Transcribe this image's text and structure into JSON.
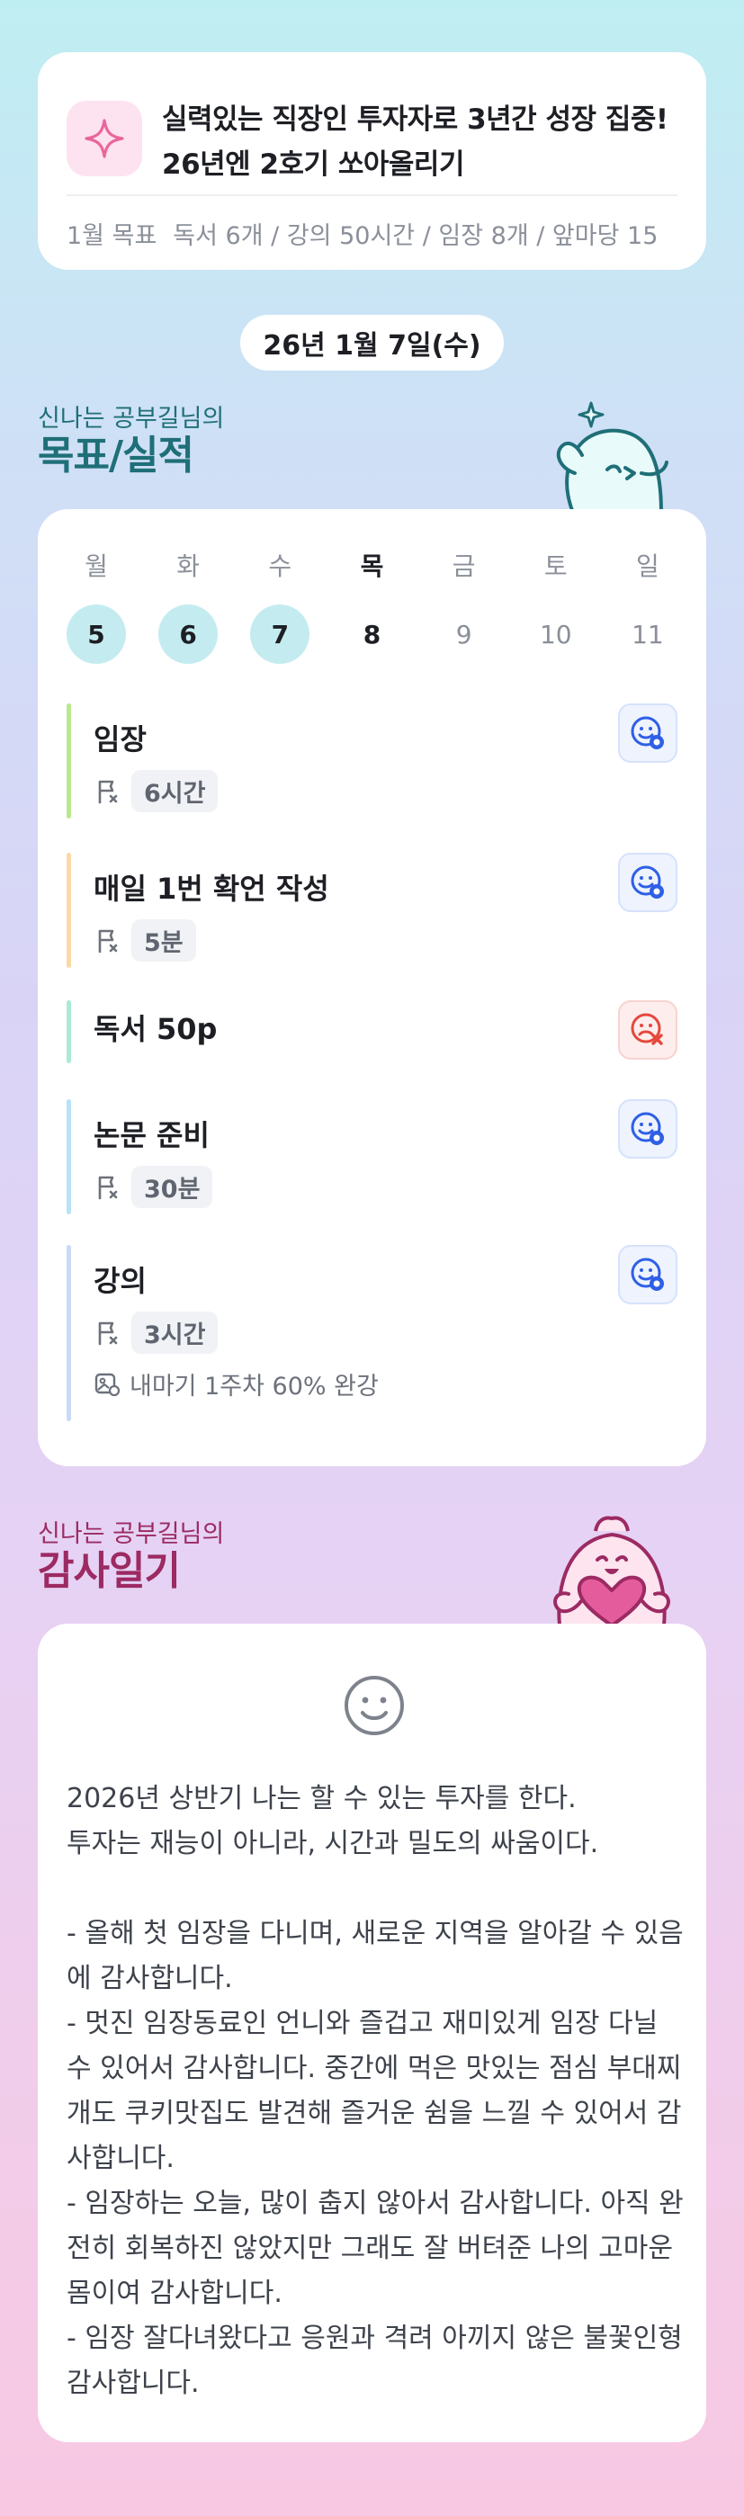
{
  "goal": {
    "title": "실력있는 직장인 투자자로 3년간 성장 집중! 26년엔 2호기 쏘아올리기",
    "month_label": "1월 목표",
    "items": "독서 6개 / 강의 50시간 / 임장 8개 / 앞마당 15",
    "icon": "sparkle-icon",
    "accent": "#e8669b"
  },
  "date": "26년 1월 7일(수)",
  "plan_section": {
    "pre": "신나는 공부길님의",
    "title": "목표/실적",
    "color": "#1f6f78"
  },
  "week": {
    "days": [
      {
        "wd": "월",
        "num": "5",
        "state": "done"
      },
      {
        "wd": "화",
        "num": "6",
        "state": "done"
      },
      {
        "wd": "수",
        "num": "7",
        "state": "done"
      },
      {
        "wd": "목",
        "num": "8",
        "state": "today"
      },
      {
        "wd": "금",
        "num": "9",
        "state": "future"
      },
      {
        "wd": "토",
        "num": "10",
        "state": "future"
      },
      {
        "wd": "일",
        "num": "11",
        "state": "future"
      }
    ]
  },
  "tasks": [
    {
      "name": "임장",
      "duration": "6시간",
      "bar_color": "#b9e88e",
      "status": "success"
    },
    {
      "name": "매일 1번 확언 작성",
      "duration": "5분",
      "bar_color": "#f9d9a6",
      "status": "success"
    },
    {
      "name": "독서 50p",
      "bar_color": "#a9ead6",
      "status": "fail"
    },
    {
      "name": "논문 준비",
      "duration": "30분",
      "bar_color": "#b8e3f7",
      "status": "success"
    },
    {
      "name": "강의",
      "duration": "3시간",
      "note": "내마기 1주차 60% 완강",
      "bar_color": "#c9d9f6",
      "status": "success"
    }
  ],
  "diary_section": {
    "pre": "신나는 공부길님의",
    "title": "감사일기",
    "color": "#9c2a63"
  },
  "diary": {
    "mood_icon": "smile-icon",
    "text": "2026년 상반기 나는 할 수 있는 투자를 한다.\n투자는 재능이 아니라, 시간과 밀도의 싸움이다.\n\n- 올해 첫 임장을 다니며, 새로운 지역을 알아갈 수 있음에 감사합니다.\n- 멋진 임장동료인 언니와 즐겁고 재미있게 임장 다닐 수 있어서 감사합니다. 중간에 먹은 맛있는 점심 부대찌개도 쿠키맛집도 발견해 즐거운 쉼을 느낄 수 있어서 감사합니다.\n- 임장하는 오늘, 많이 춥지 않아서 감사합니다. 아직 완전히 회복하진 않았지만 그래도 잘 버텨준 나의 고마운 몸이여 감사합니다.\n- 임장 잘다녀왔다고 응원과 격려 아끼지 않은 불꽃인형 감사합니다."
  }
}
